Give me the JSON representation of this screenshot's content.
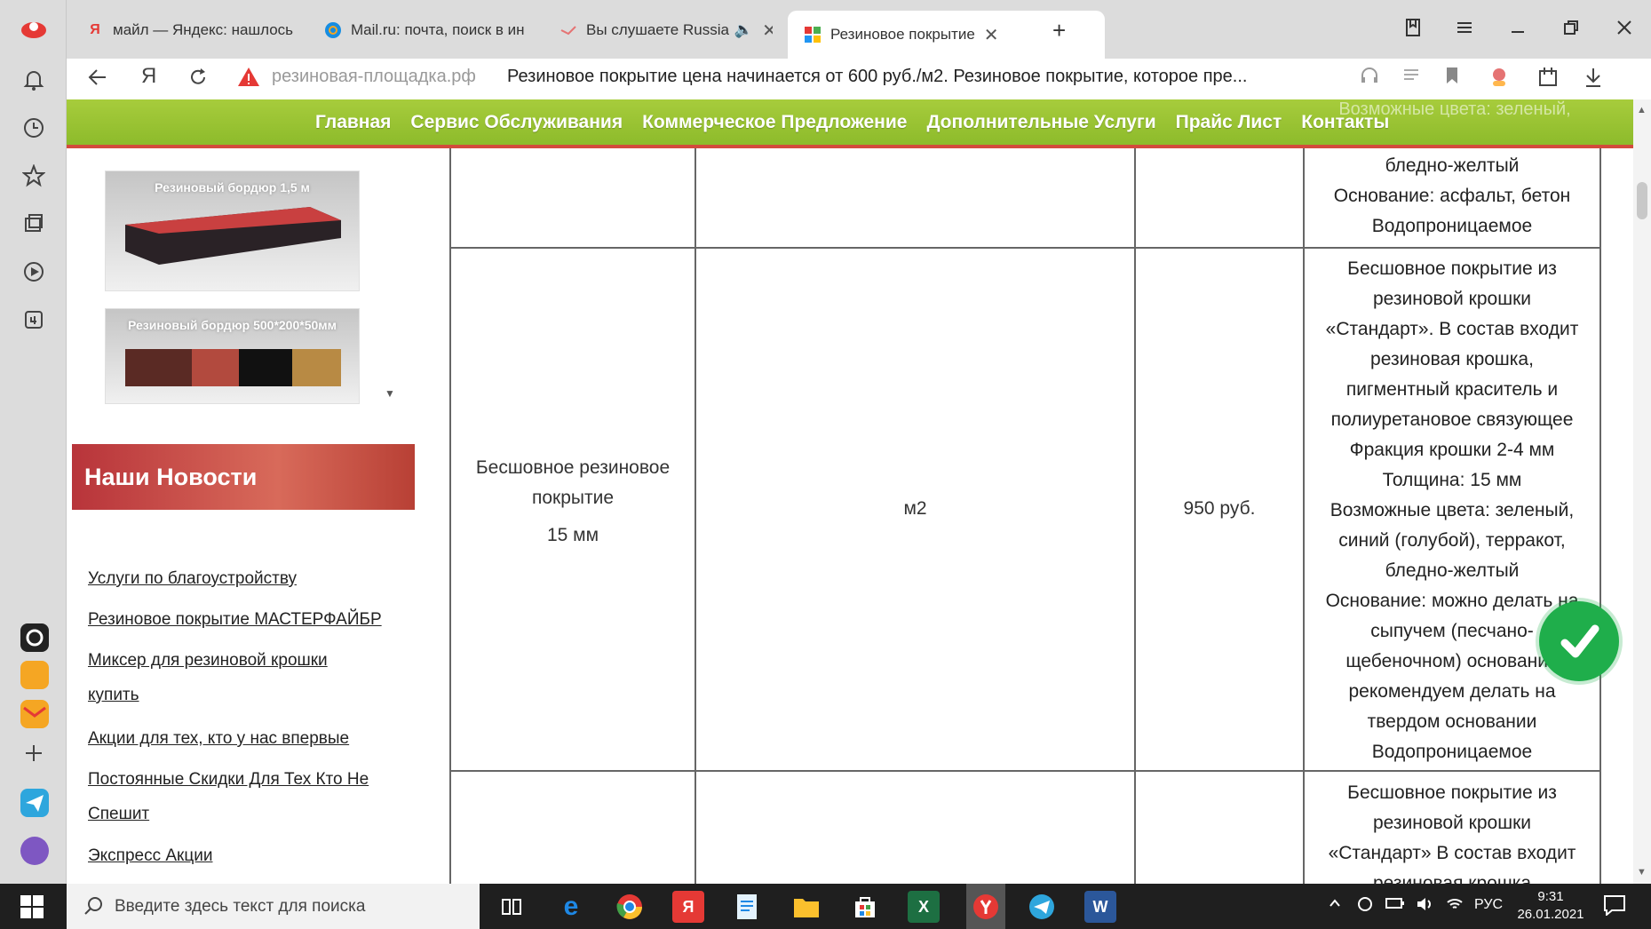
{
  "browser": {
    "tabs": [
      {
        "label": "майл — Яндекс: нашлось",
        "icon": "yandex-icon",
        "color": "#e53935"
      },
      {
        "label": "Mail.ru: почта, поиск в ин",
        "icon": "mailru-icon",
        "color": "#168de2"
      },
      {
        "label": "Вы слушаете Russia",
        "icon": "radio-icon",
        "color": "#e57373"
      },
      {
        "label": "Резиновое покрытие",
        "icon": "site-icon",
        "color": "#4caf50"
      }
    ],
    "new_tab_label": "+",
    "close_glyph": "✕",
    "address_domain": "резиновая-площадка.рф",
    "page_title": "Резиновое покрытие цена начинается от 600 руб./м2. Резиновое покрытие, которое пре..."
  },
  "site": {
    "nav": [
      "Главная",
      "Сервис Обслуживания",
      "Коммерческое Предложение",
      "Дополнительные Услуги",
      "Прайс Лист",
      "Контакты"
    ],
    "nav_overlay_text": "Возможные цвета: зеленый,",
    "products": [
      {
        "caption": "Резиновый бордюр 1,5 м"
      },
      {
        "caption": "Резиновый бордюр 500*200*50мм"
      }
    ],
    "news_title": "Наши Новости",
    "news_links": [
      "Услуги по благоустройству",
      "Резиновое покрытие МАСТЕРФАЙБР",
      "Миксер для резиновой крошки купить",
      "Акции для тех, кто у нас впервые",
      "Постоянные Скидки Для Тех Кто Не Спешит",
      "Экспресс Акции"
    ],
    "table": {
      "top_desc": [
        "бледно-желтый",
        "Основание: асфальт, бетон",
        "Водопроницаемое"
      ],
      "row": {
        "name_line1": "Бесшовное резиновое",
        "name_line2": "покрытие",
        "thickness": "15 мм",
        "unit": "м2",
        "price": "950 руб.",
        "desc": [
          "Бесшовное покрытие из",
          "резиновой крошки",
          "«Стандарт». В состав входит",
          "резиновая крошка,",
          "пигментный краситель и",
          "полиуретановое связующее",
          "Фракция крошки 2-4 мм",
          "Толщина: 15 мм",
          "Возможные цвета: зеленый,",
          "синий (голубой), терракот,",
          "бледно-желтый",
          "Основание: можно делать на",
          "сыпучем (песчано-",
          "щебеночном) основании",
          "рекомендуем делать на",
          "твердом основании",
          "Водопроницаемое"
        ]
      },
      "bottom_desc": [
        "Бесшовное покрытие из",
        "резиновой крошки",
        "«Стандарт» В состав входит",
        "резиновая крошка"
      ]
    }
  },
  "taskbar": {
    "search_placeholder": "Введите здесь текст для поиска",
    "lang": "РУС",
    "time": "9:31",
    "date": "26.01.2021"
  }
}
